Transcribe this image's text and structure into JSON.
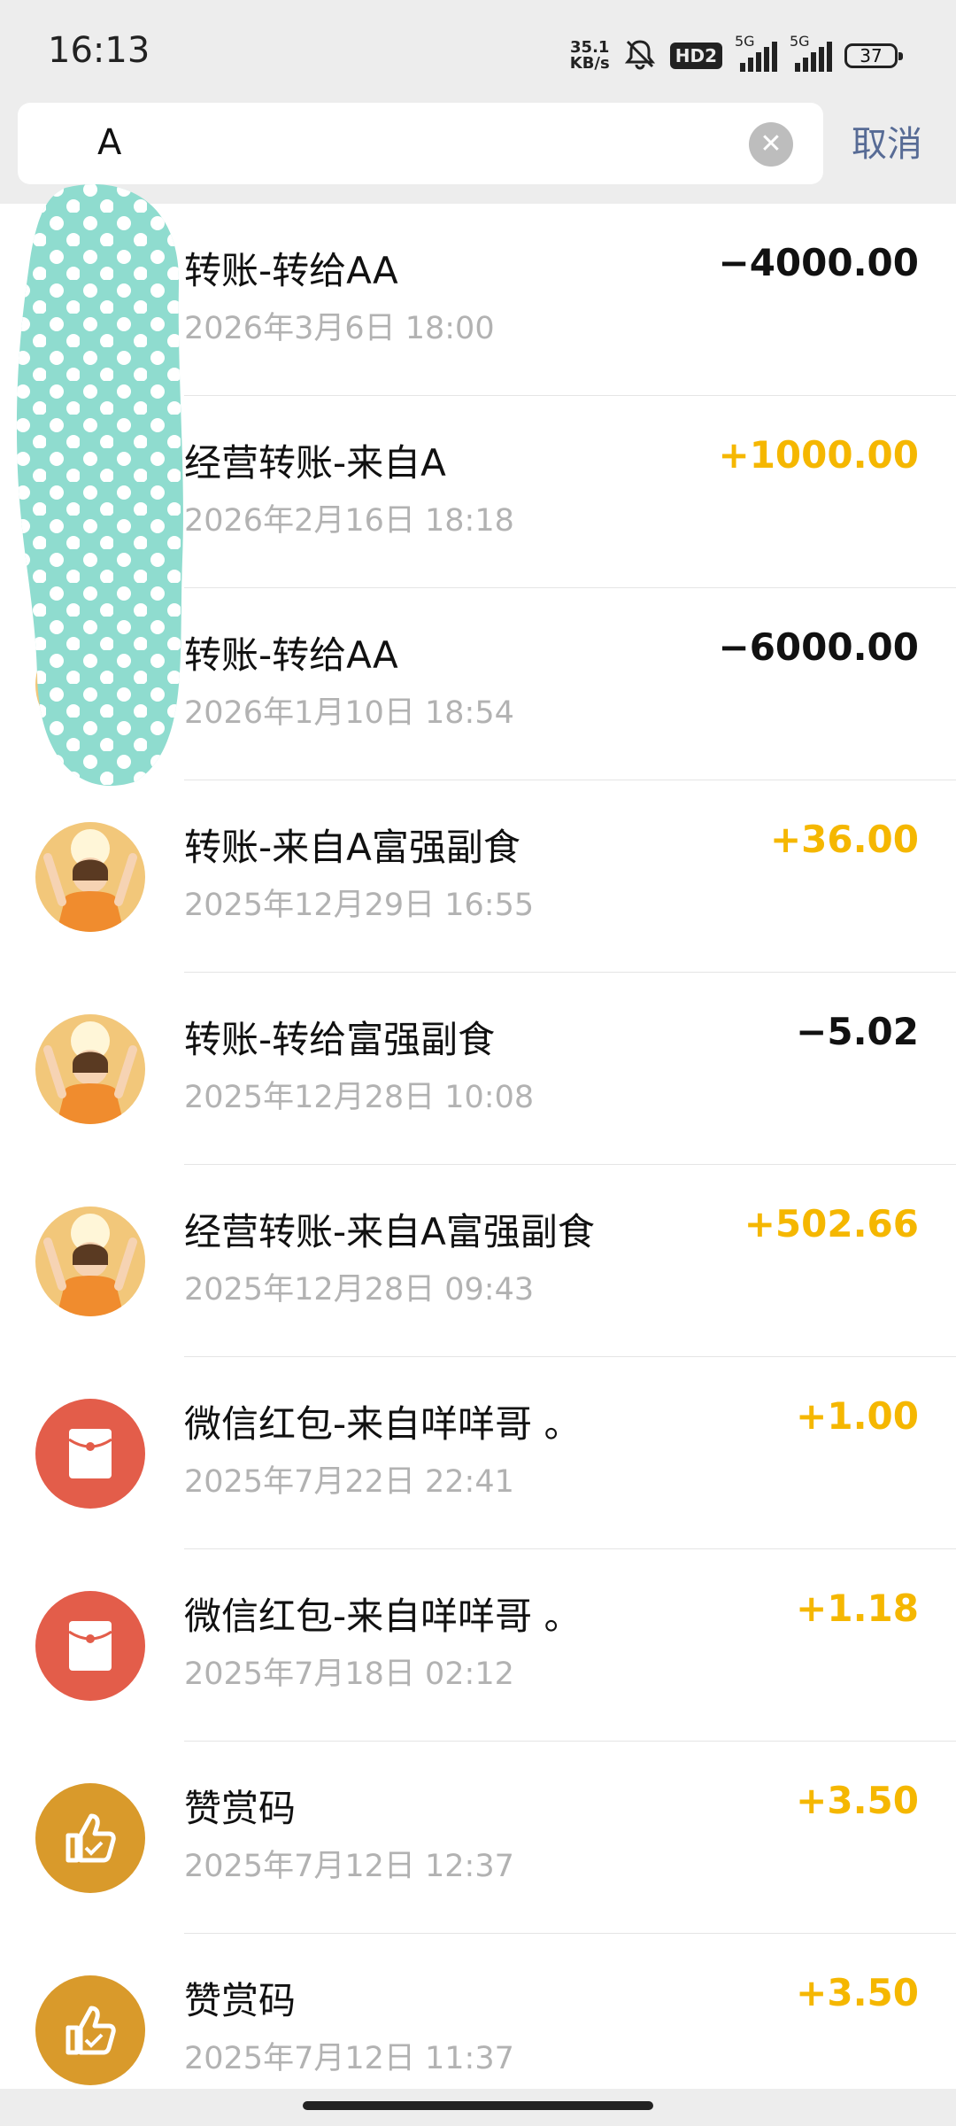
{
  "status_bar": {
    "time": "16:13",
    "net_speed_value": "35.1",
    "net_speed_unit": "KB/s",
    "hd_label": "HD2",
    "network_label": "5G",
    "battery": "37"
  },
  "search": {
    "query": "A",
    "cancel_label": "取消"
  },
  "colors": {
    "income": "#f5b700",
    "expense": "#111111",
    "cancel": "#576b95",
    "red_packet": "#e35d4a",
    "reward": "#d99a2b"
  },
  "transactions": [
    {
      "title": "转账-转给AA",
      "date": "2026年3月6日 18:00",
      "amount": "−4000.00",
      "direction": "out",
      "icon": "user-avatar"
    },
    {
      "title": "经营转账-来自A",
      "date": "2026年2月16日 18:18",
      "amount": "+1000.00",
      "direction": "in",
      "icon": "user-avatar"
    },
    {
      "title": "转账-转给AA",
      "date": "2026年1月10日 18:54",
      "amount": "−6000.00",
      "direction": "out",
      "icon": "user-avatar"
    },
    {
      "title": "转账-来自A富强副食",
      "date": "2025年12月29日 16:55",
      "amount": "+36.00",
      "direction": "in",
      "icon": "person-avatar"
    },
    {
      "title": "转账-转给富强副食",
      "date": "2025年12月28日 10:08",
      "amount": "−5.02",
      "direction": "out",
      "icon": "person-avatar"
    },
    {
      "title": "经营转账-来自A富强副食",
      "date": "2025年12月28日 09:43",
      "amount": "+502.66",
      "direction": "in",
      "icon": "person-avatar"
    },
    {
      "title": "微信红包-来自咩咩哥 。",
      "date": "2025年7月22日 22:41",
      "amount": "+1.00",
      "direction": "in",
      "icon": "red-packet-icon"
    },
    {
      "title": "微信红包-来自咩咩哥 。",
      "date": "2025年7月18日 02:12",
      "amount": "+1.18",
      "direction": "in",
      "icon": "red-packet-icon"
    },
    {
      "title": "赞赏码",
      "date": "2025年7月12日 12:37",
      "amount": "+3.50",
      "direction": "in",
      "icon": "thumbs-up-icon"
    },
    {
      "title": "赞赏码",
      "date": "2025年7月12日 11:37",
      "amount": "+3.50",
      "direction": "in",
      "icon": "thumbs-up-icon"
    }
  ]
}
